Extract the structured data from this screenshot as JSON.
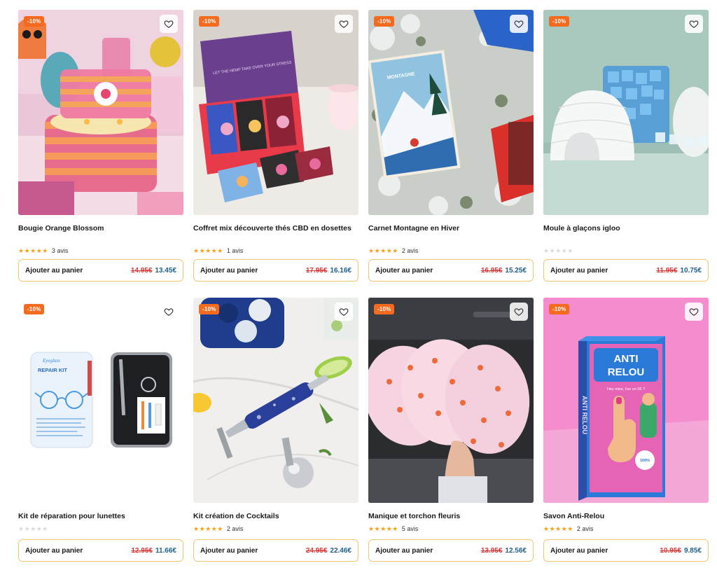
{
  "products": [
    {
      "title": "Bougie Orange Blossom",
      "badge": "-10%",
      "rating_count": "3 avis",
      "stars": "★★★★★",
      "old_price": "14.95€",
      "new_price": "13.45€",
      "cart_label": "Ajouter au panier"
    },
    {
      "title": "Coffret mix découverte thés CBD en dosettes",
      "badge": "-10%",
      "rating_count": "1 avis",
      "stars": "★★★★★",
      "old_price": "17.95€",
      "new_price": "16.16€",
      "cart_label": "Ajouter au panier"
    },
    {
      "title": "Carnet Montagne en Hiver",
      "badge": "-10%",
      "rating_count": "2 avis",
      "stars": "★★★★★",
      "old_price": "16.95€",
      "new_price": "15.25€",
      "cart_label": "Ajouter au panier"
    },
    {
      "title": "Moule à glaçons igloo",
      "badge": "-10%",
      "rating_count": "",
      "stars": "★★★★★",
      "old_price": "11.95€",
      "new_price": "10.75€",
      "cart_label": "Ajouter au panier"
    },
    {
      "title": "Kit de réparation pour lunettes",
      "badge": "-10%",
      "rating_count": "",
      "stars": "★★★★★",
      "old_price": "12.95€",
      "new_price": "11.66€",
      "cart_label": "Ajouter au panier"
    },
    {
      "title": "Kit création de Cocktails",
      "badge": "-10%",
      "rating_count": "2 avis",
      "stars": "★★★★★",
      "old_price": "24.95€",
      "new_price": "22.46€",
      "cart_label": "Ajouter au panier"
    },
    {
      "title": "Manique et torchon fleuris",
      "badge": "-10%",
      "rating_count": "5 avis",
      "stars": "★★★★★",
      "old_price": "13.95€",
      "new_price": "12.56€",
      "cart_label": "Ajouter au panier"
    },
    {
      "title": "Savon Anti-Relou",
      "badge": "-10%",
      "rating_count": "2 avis",
      "stars": "★★★★★",
      "old_price": "10.95€",
      "new_price": "9.85€",
      "cart_label": "Ajouter au panier"
    }
  ],
  "image_text": {
    "coffret_lid": "LET THE HEMP TAKE OVER YOUR STRESS",
    "carnet_title": "MONTAGNE",
    "repair_brand": "Eyeglass",
    "repair_title": "REPAIR KIT",
    "soap_line1": "ANTI",
    "soap_line2": "RELOU",
    "soap_side": "ANTI RELOU",
    "soap_tag": "Hey miss, t'as un 06 ?",
    "soap_pct": "100%"
  },
  "colors": {
    "badge": "#f46a1e",
    "star": "#f6a21a",
    "cart_border": "#f3c66e",
    "old_price": "#d83a3a",
    "new_price": "#1e5f8a"
  },
  "icons": {
    "favorite": "heart-outline-icon"
  }
}
